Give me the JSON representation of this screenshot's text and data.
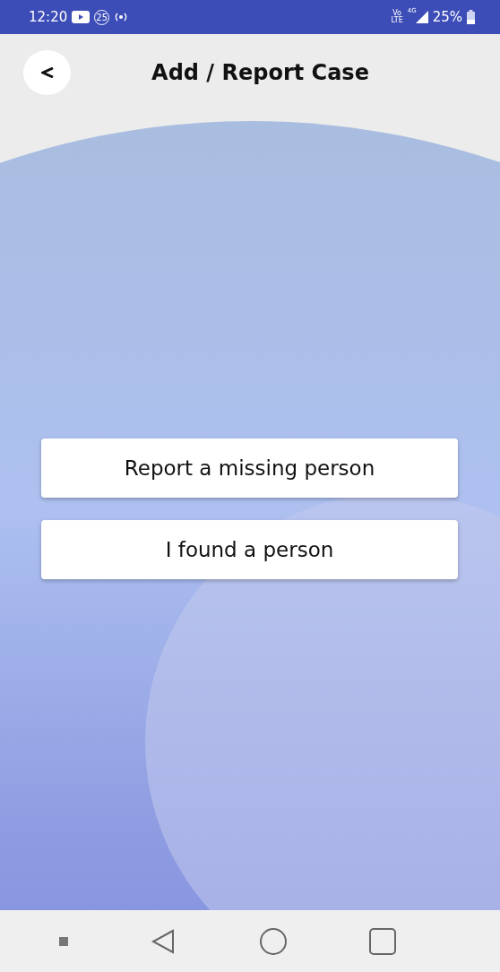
{
  "status_bar": {
    "time": "12:20",
    "badge": "25",
    "volte_top": "Vo",
    "volte_bottom": "LTE",
    "network": "4G",
    "battery": "25%"
  },
  "header": {
    "title": "Add / Report Case"
  },
  "options": [
    {
      "label": "Report a missing person"
    },
    {
      "label": "I found a person"
    }
  ]
}
